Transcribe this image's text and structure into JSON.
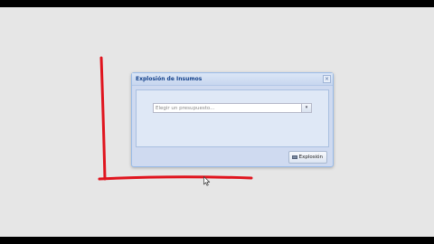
{
  "dialog": {
    "title": "Explosión de Insumos",
    "close_label": "×",
    "combo": {
      "placeholder": "Elegir un presupuesto...",
      "trigger_glyph": "▾"
    },
    "action_button": {
      "label": "Explosión",
      "icon": "table-icon"
    }
  },
  "colors": {
    "annotation_stroke": "#e0141e",
    "desktop_background": "#e6e6e6",
    "panel_background": "#cfdaf0"
  }
}
